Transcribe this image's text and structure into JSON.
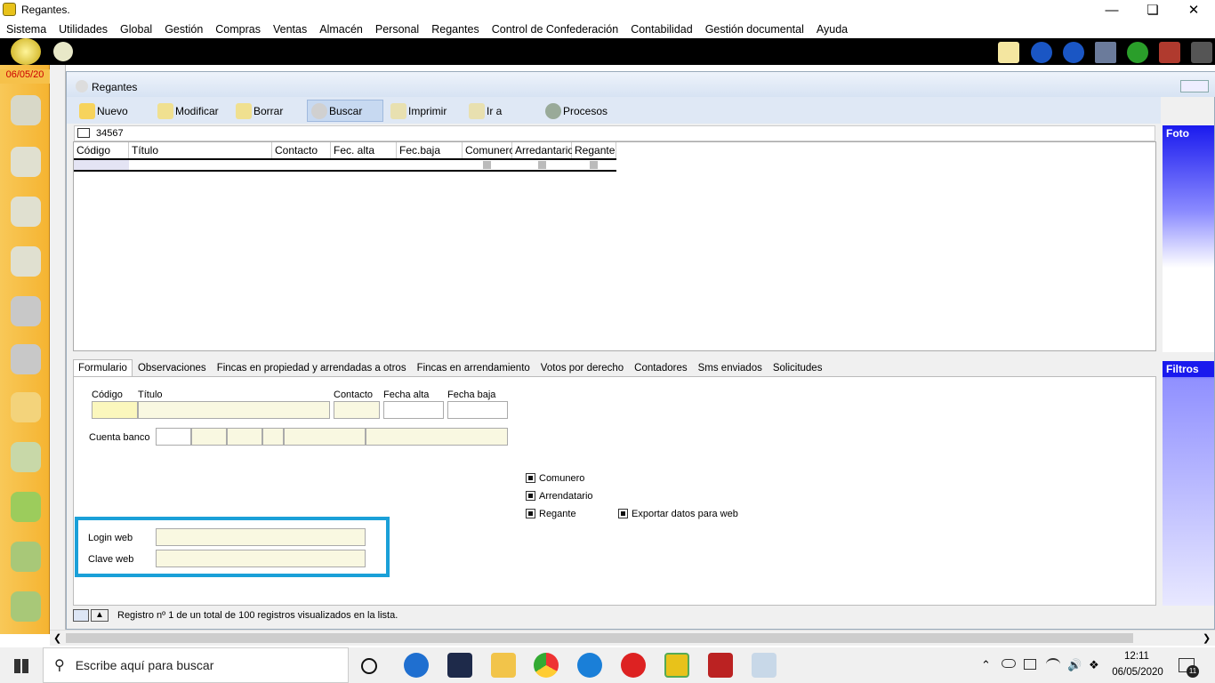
{
  "titlebar": {
    "title": "Regantes."
  },
  "menubar": [
    "Sistema",
    "Utilidades",
    "Global",
    "Gestión",
    "Compras",
    "Ventas",
    "Almacén",
    "Personal",
    "Regantes",
    "Control de Confederación",
    "Contabilidad",
    "Gestión documental",
    "Ayuda"
  ],
  "leftbar": {
    "date": "06/05/20"
  },
  "window": {
    "title": "Regantes",
    "toolbar": [
      "Nuevo",
      "Modificar",
      "Borrar",
      "Buscar",
      "Imprimir",
      "Ir a",
      "Procesos"
    ],
    "search_value": "34567",
    "list_headers": [
      "Código",
      "Título",
      "Contacto",
      "Fec. alta",
      "Fec.baja",
      "Comunero",
      "Arredantario",
      "Regante"
    ],
    "right_panels": {
      "foto": "Foto",
      "filtros": "Filtros"
    },
    "tabs": [
      "Formulario",
      "Observaciones",
      "Fincas en propiedad y arrendadas a otros",
      "Fincas en arrendamiento",
      "Votos por derecho",
      "Contadores",
      "Sms enviados",
      "Solicitudes"
    ],
    "form": {
      "codigo": "Código",
      "titulo": "Título",
      "contacto": "Contacto",
      "fecha_alta": "Fecha alta",
      "fecha_baja": "Fecha baja",
      "cuenta_banco": "Cuenta banco",
      "login_web": "Login web",
      "clave_web": "Clave web",
      "comunero": "Comunero",
      "arrendatario": "Arrendatario",
      "regante": "Regante",
      "exportar": "Exportar datos para web"
    },
    "status": "Registro nº 1 de un total de 100 registros visualizados en la lista."
  },
  "taskbar": {
    "search_placeholder": "Escribe aquí para buscar",
    "time": "12:11",
    "date": "06/05/2020",
    "notif": "11"
  },
  "colors": {
    "highlight_box": "#1aa0d8",
    "left_bar": "#f5b431",
    "field_bg": "#f9f8e1"
  }
}
